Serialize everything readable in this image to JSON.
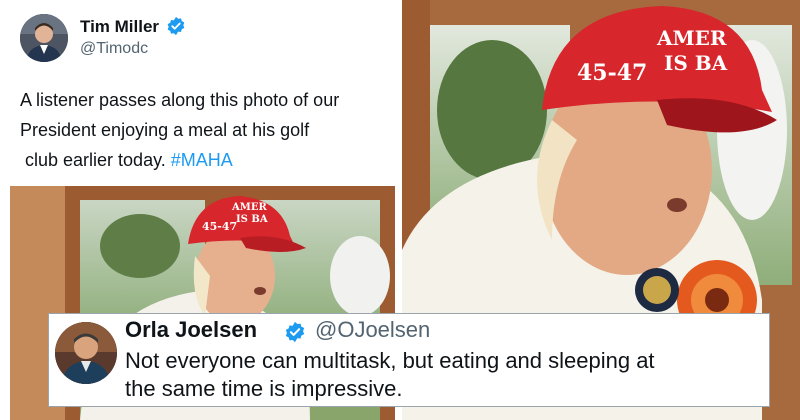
{
  "tweet": {
    "author_name": "Tim Miller",
    "author_handle": "@Timodc",
    "text_line1": "A listener passes along this photo of our",
    "text_line2": "President enjoying a meal at his  golf",
    "text_line3": "club earlier today. ",
    "hashtag": "#MAHA"
  },
  "photo": {
    "hat_line1": "AMER",
    "hat_line2": "IS BA",
    "hat_number": "45-47"
  },
  "reply": {
    "author_name": "Orla Joelsen",
    "author_handle": "@OJoelsen",
    "text_line1": "Not everyone can multitask, but eating and sleeping at",
    "text_line2": "the same time is impressive."
  },
  "colors": {
    "text": "#0f1419",
    "secondary": "#536471",
    "link": "#1d9bf0",
    "verified": "#1d9bf0",
    "hat_red": "#d7262c"
  },
  "icons": {
    "verified": "verified-badge-icon"
  }
}
